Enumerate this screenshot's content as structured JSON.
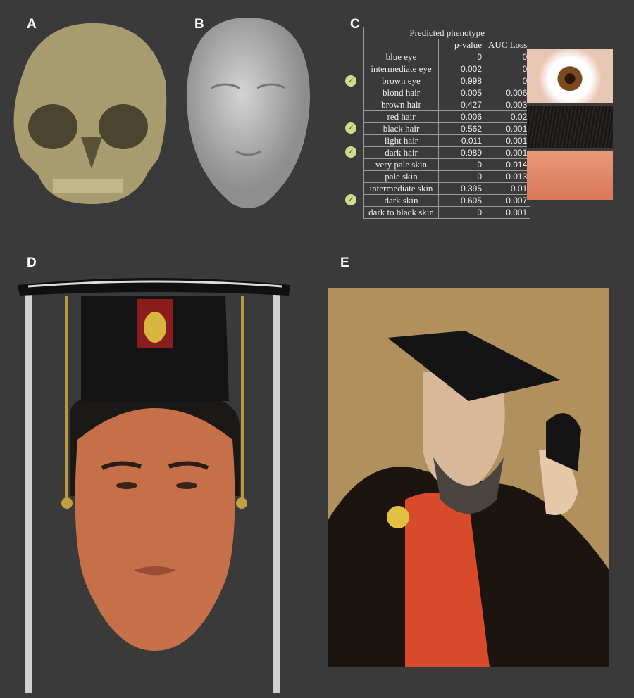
{
  "panels": {
    "a": "A",
    "b": "B",
    "c": "C",
    "d": "D",
    "e": "E"
  },
  "table": {
    "title": "Predicted phenotype",
    "columns": [
      "",
      "p-value",
      "AUC Loss"
    ],
    "rows": [
      {
        "name": "blue eye",
        "p": "0",
        "auc": "0",
        "checked": false
      },
      {
        "name": "intermediate eye",
        "p": "0.002",
        "auc": "0",
        "checked": false
      },
      {
        "name": "brown eye",
        "p": "0.998",
        "auc": "0",
        "checked": true
      },
      {
        "name": "blond hair",
        "p": "0.005",
        "auc": "0.006",
        "checked": false
      },
      {
        "name": "brown hair",
        "p": "0.427",
        "auc": "0.003",
        "checked": false
      },
      {
        "name": "red hair",
        "p": "0.006",
        "auc": "0.02",
        "checked": false
      },
      {
        "name": "black hair",
        "p": "0.562",
        "auc": "0.001",
        "checked": true
      },
      {
        "name": "light hair",
        "p": "0.011",
        "auc": "0.001",
        "checked": false
      },
      {
        "name": "dark hair",
        "p": "0.989",
        "auc": "0.001",
        "checked": true
      },
      {
        "name": "very pale skin",
        "p": "0",
        "auc": "0.014",
        "checked": false
      },
      {
        "name": "pale skin",
        "p": "0",
        "auc": "0.013",
        "checked": false
      },
      {
        "name": "intermediate skin",
        "p": "0.395",
        "auc": "0.01",
        "checked": false
      },
      {
        "name": "dark skin",
        "p": "0.605",
        "auc": "0.007",
        "checked": true
      },
      {
        "name": "dark to black skin",
        "p": "0",
        "auc": "0.001",
        "checked": false
      }
    ]
  },
  "colors": {
    "background": "#3a3a3a",
    "skull": "#a89c6e",
    "face_model": "#b8b8b8",
    "eye": "#7a4a1c",
    "hair": "#1a1615",
    "skin": "#e08a6a",
    "check": "#c9dc8f"
  }
}
